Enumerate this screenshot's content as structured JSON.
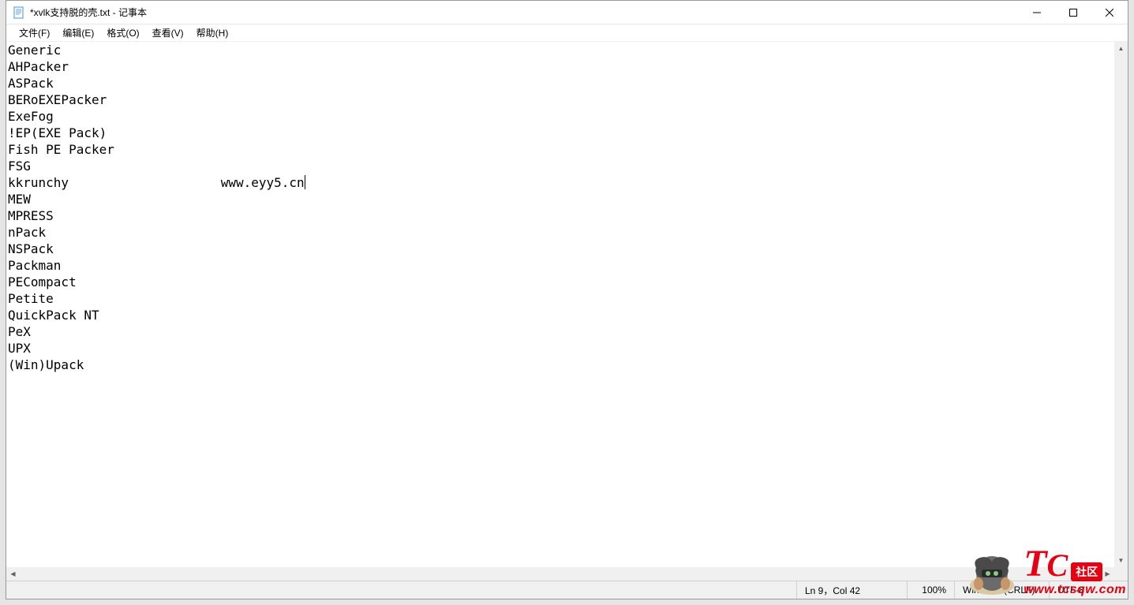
{
  "window": {
    "title": "*xvlk支持脱的壳.txt - 记事本"
  },
  "menu": {
    "file": "文件(F)",
    "edit": "编辑(E)",
    "format": "格式(O)",
    "view": "查看(V)",
    "help": "帮助(H)"
  },
  "content": {
    "lines": [
      "Generic",
      "AHPacker",
      "ASPack",
      "BERoEXEPacker",
      "ExeFog",
      "!EP(EXE Pack)",
      "Fish PE Packer",
      "FSG",
      "kkrunchy                    www.eyy5.cn",
      "MEW",
      "MPRESS",
      "nPack",
      "NSPack",
      "Packman",
      "PECompact",
      "Petite",
      "QuickPack NT",
      "PeX",
      "UPX",
      "(Win)Upack"
    ],
    "cursor_line_index": 8
  },
  "status": {
    "position": "Ln 9，Col 42",
    "zoom": "100%",
    "line_ending": "Windows (CRLF)",
    "encoding": "UTF-8"
  },
  "watermark": {
    "brand_t": "T",
    "brand_c": "C",
    "badge": "社区",
    "url": "www.tcsqw.com"
  }
}
